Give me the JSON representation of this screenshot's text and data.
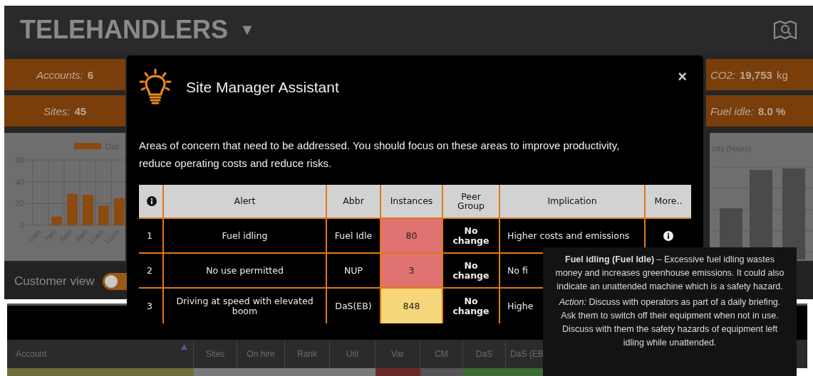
{
  "header": {
    "title": "TELEHANDLERS",
    "caret": "▼"
  },
  "stats_left": [
    {
      "label": "Accounts:",
      "value": "6"
    },
    {
      "label": "Sites:",
      "value": "45"
    }
  ],
  "stats_right": [
    {
      "label": "CO2:",
      "value": "19,753",
      "unit": "kg"
    },
    {
      "label": "Fuel idle:",
      "value": "8.0 %"
    }
  ],
  "left_chart": {
    "chart_data": {
      "type": "bar",
      "categories": [
        "6am",
        "7am",
        "8am",
        "9am",
        "10am",
        "11am"
      ],
      "series": [
        {
          "name": "Dail",
          "color": "#8a4a12",
          "values": [
            0,
            8,
            29,
            28,
            18,
            25
          ]
        }
      ],
      "yticks": [
        0,
        20,
        40,
        60
      ],
      "ylim": [
        0,
        60
      ]
    }
  },
  "right_chart": {
    "title": "city (hours)"
  },
  "customer_view": {
    "label": "Customer view",
    "on": false
  },
  "table": {
    "columns": [
      {
        "label": "Account",
        "sorted": true
      },
      {
        "label": "Sites",
        "sorted": false
      },
      {
        "label": "On hire",
        "sorted": false
      },
      {
        "label": "Rank",
        "sorted": false
      },
      {
        "label": "Util",
        "sorted": false
      },
      {
        "label": "Var",
        "sorted": false
      },
      {
        "label": "CM",
        "sorted": false
      },
      {
        "label": "DaS",
        "sorted": false
      },
      {
        "label": "DaS (EB",
        "sorted": false
      }
    ],
    "row_colors": [
      {
        "color": "#6e6e3c"
      },
      {
        "color": "#7a7a7a"
      },
      {
        "color": "#7a7a7a"
      },
      {
        "color": "#7a7a7a"
      },
      {
        "color": "#7a7a7a"
      },
      {
        "color": "#6a2a2a"
      },
      {
        "color": "#555555"
      },
      {
        "color": "#3d6b34"
      },
      {
        "color": "#3d6b34"
      }
    ]
  },
  "modal": {
    "title": "Site Manager Assistant",
    "close": "×",
    "description": "Areas of concern that need to be addressed. You should focus on these areas to improve productivity, reduce operating costs and reduce risks.",
    "columns": [
      "Alert",
      "Abbr",
      "Instances",
      "Peer Group",
      "Implication",
      "More.."
    ],
    "rows": [
      {
        "number": "1",
        "alert": "Fuel idling",
        "abbr": "Fuel Idle",
        "instances": "80",
        "color": "#e07272",
        "peer": "No change",
        "implication": "Higher costs and emissions",
        "more": true
      },
      {
        "number": "2",
        "alert": "No use permitted",
        "abbr": "NUP",
        "instances": "3",
        "color": "#e07272",
        "peer": "No change",
        "implication": "No fi"
      },
      {
        "number": "3",
        "alert": "Driving at speed with elevated boom",
        "abbr": "DaS(EB)",
        "instances": "848",
        "color": "#f6d77c",
        "peer": "No change",
        "implication": "Highe"
      }
    ]
  },
  "tooltip": {
    "paragraphs": [
      "**Fuel idling (Fuel Idle)** – Excessive fuel idling wastes money and increases greenhouse emissions. It could also indicate an unattended machine which is a safety hazard.",
      "*Action:* Discuss with operators as part of a daily briefing. Ask them to switch off their equipment when not in use. Discuss with them the safety hazards of equipment left idling while unattended."
    ]
  }
}
